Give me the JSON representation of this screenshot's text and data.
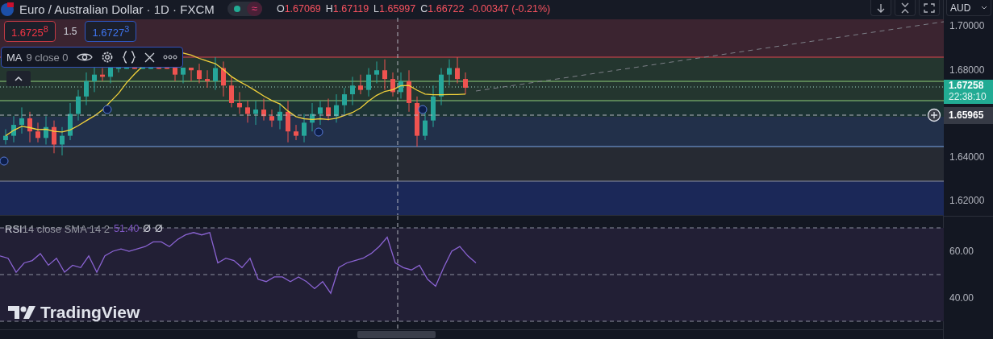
{
  "header": {
    "symbol_title": "Euro / Australian Dollar · 1D · FXCM",
    "status_glyph": "≈",
    "ohlc": [
      {
        "label": "O",
        "value": "1.67069"
      },
      {
        "label": "H",
        "value": "1.67119"
      },
      {
        "label": "L",
        "value": "1.65997"
      },
      {
        "label": "C",
        "value": "1.66722"
      }
    ],
    "change": "-0.00347 (-0.21%)"
  },
  "trade": {
    "sell": "1.6725$^{8}$",
    "spread": "1.5",
    "buy": "1.6727$^{3}$"
  },
  "ma_legend": {
    "name": "MA",
    "params": "9 close 0"
  },
  "rsi_legend": {
    "name": "RSI",
    "params": "14 close SMA 14 2",
    "values": [
      "51.40",
      "Ø",
      "Ø"
    ]
  },
  "price_axis": {
    "currency": "AUD",
    "ticks": [
      "1.70000",
      "1.68000",
      "1.64000",
      "1.62000"
    ],
    "last_price": "1.67258",
    "countdown": "22:38:10",
    "crosshair_price": "1.65965"
  },
  "rsi_axis": {
    "ticks": [
      "60.00",
      "40.00"
    ]
  },
  "logo": "TradingView"
}
